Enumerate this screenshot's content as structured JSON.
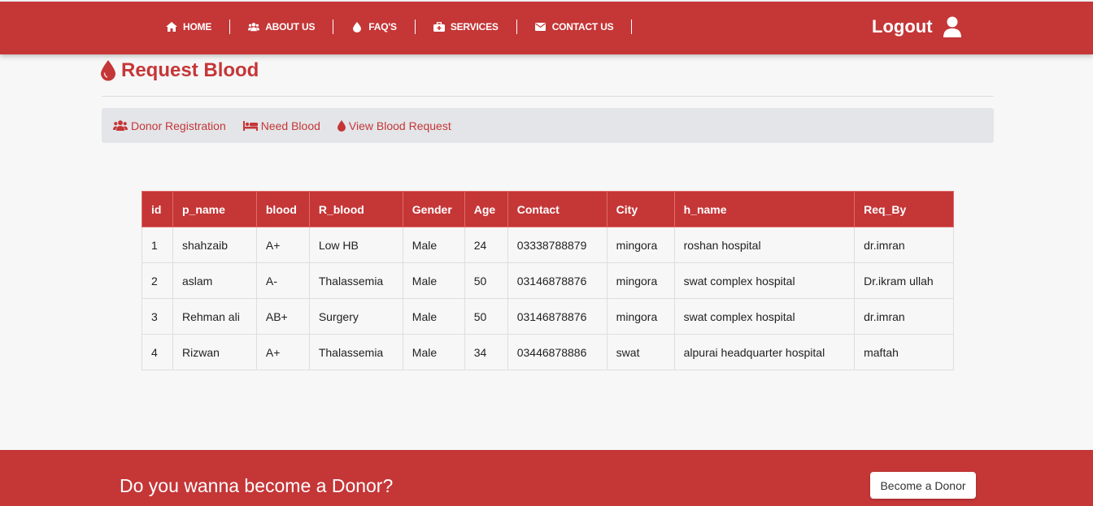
{
  "nav": {
    "items": [
      {
        "label": "HOME",
        "icon": "home-icon"
      },
      {
        "label": "ABOUT US",
        "icon": "users-icon"
      },
      {
        "label": "FAQ'S",
        "icon": "drop-icon"
      },
      {
        "label": "SERVICES",
        "icon": "medkit-icon"
      },
      {
        "label": "CONTACT US",
        "icon": "envelope-icon"
      }
    ],
    "logout_label": "Logout"
  },
  "page": {
    "title": "Request Blood"
  },
  "subnav": {
    "items": [
      {
        "label": "Donor Registration",
        "icon": "users-icon"
      },
      {
        "label": "Need Blood",
        "icon": "bed-icon"
      },
      {
        "label": "View Blood Request",
        "icon": "drop-icon"
      }
    ]
  },
  "table": {
    "headers": [
      "id",
      "p_name",
      "blood",
      "R_blood",
      "Gender",
      "Age",
      "Contact",
      "City",
      "h_name",
      "Req_By"
    ],
    "rows": [
      [
        "1",
        "shahzaib",
        "A+",
        "Low HB",
        "Male",
        "24",
        "03338788879",
        "mingora",
        "roshan hospital",
        "dr.imran"
      ],
      [
        "2",
        "aslam",
        "A-",
        "Thalassemia",
        "Male",
        "50",
        "03146878876",
        "mingora",
        "swat complex hospital",
        "Dr.ikram ullah"
      ],
      [
        "3",
        "Rehman ali",
        "AB+",
        "Surgery",
        "Male",
        "50",
        "03146878876",
        "mingora",
        "swat complex hospital",
        "dr.imran"
      ],
      [
        "4",
        "Rizwan",
        "A+",
        "Thalassemia",
        "Male",
        "34",
        "03446878886",
        "swat",
        "alpurai headquarter hospital",
        "maftah"
      ]
    ]
  },
  "footer": {
    "text": "Do you wanna become a Donor?",
    "button_label": "Become a Donor"
  },
  "colors": {
    "brand": "#c53637",
    "subnav_bg": "#e3e5e8",
    "page_bg": "#f7f7f7"
  }
}
